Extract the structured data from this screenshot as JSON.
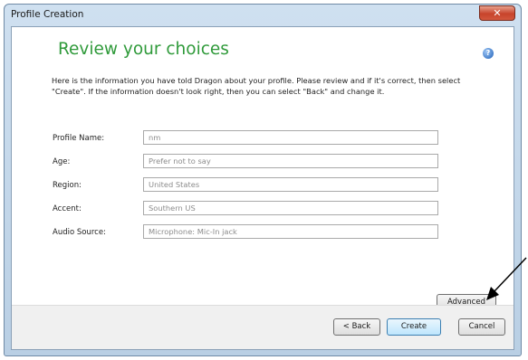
{
  "window": {
    "title": "Profile Creation",
    "close_glyph": "✕"
  },
  "page": {
    "heading": "Review your choices",
    "help_glyph": "?",
    "intro": "Here is the information you have told Dragon about your profile.  Please review and if it's correct, then select \"Create\".  If the information doesn't look right, then you can select \"Back\" and change it."
  },
  "fields": [
    {
      "label": "Profile Name:",
      "value": "nm"
    },
    {
      "label": "Age:",
      "value": "Prefer not to say"
    },
    {
      "label": "Region:",
      "value": "United States"
    },
    {
      "label": "Accent:",
      "value": "Southern US"
    },
    {
      "label": "Audio Source:",
      "value": "Microphone: Mic-In jack"
    }
  ],
  "buttons": {
    "advanced": "Advanced",
    "back": "< Back",
    "create": "Create",
    "cancel": "Cancel"
  },
  "annotation": {
    "arrow_color": "#000000"
  }
}
